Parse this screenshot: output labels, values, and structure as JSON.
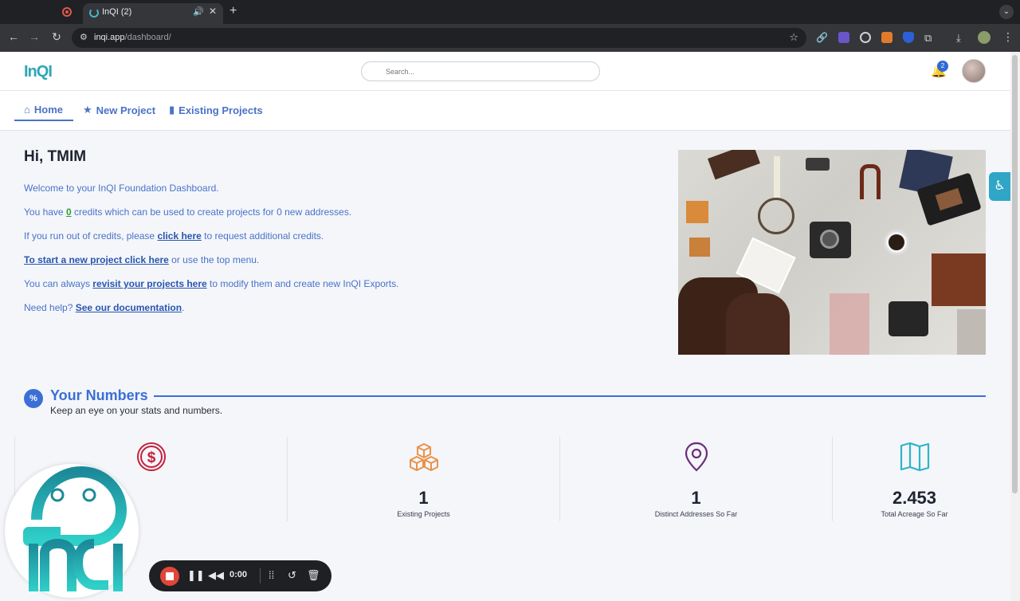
{
  "browser": {
    "tab_title": "InQI (2)",
    "url_host": "inqi.app",
    "url_path": "/dashboard/"
  },
  "header": {
    "logo": "InQI",
    "search_placeholder": "Search...",
    "notification_count": "2"
  },
  "nav": {
    "items": [
      {
        "label": "Home",
        "icon": "home-icon",
        "active": true
      },
      {
        "label": "New Project",
        "icon": "star-icon",
        "active": false
      },
      {
        "label": "Existing Projects",
        "icon": "book-icon",
        "active": false
      }
    ]
  },
  "welcome": {
    "greeting": "Hi, TMIM",
    "line1": "Welcome to your InQI Foundation Dashboard.",
    "line2_pre": "You have ",
    "line2_credits": "0",
    "line2_post": " credits which can be used to create projects for 0 new addresses.",
    "line3_pre": "If you run out of credits, please ",
    "line3_link": "click here",
    "line3_post": " to request additional credits.",
    "line4_link": "To start a new project click here",
    "line4_post": " or use the top menu.",
    "line5_pre": "You can always ",
    "line5_link": "revisit your projects here",
    "line5_post": " to modify them and create new InQI Exports.",
    "line6_pre": "Need help? ",
    "line6_link": "See our documentation",
    "line6_post": "."
  },
  "numbers": {
    "icon_glyph": "%",
    "title": "Your Numbers",
    "subtitle": "Keep an eye on your stats and numbers.",
    "stats": [
      {
        "value": "",
        "label": "",
        "icon": "dollar-icon",
        "color": "#c4213a"
      },
      {
        "value": "1",
        "label": "Existing Projects",
        "icon": "boxes-icon",
        "color": "#e8924a"
      },
      {
        "value": "1",
        "label": "Distinct Addresses So Far",
        "icon": "map-pin-icon",
        "color": "#6b2d7a"
      },
      {
        "value": "2.453",
        "label": "Total Acreage So Far",
        "icon": "map-icon",
        "color": "#2fb3c9"
      }
    ]
  },
  "recorder": {
    "time": "0:00"
  },
  "colors": {
    "brand": "#2fa6b5",
    "link": "#4a72c9",
    "accent": "#3b6fd6"
  }
}
